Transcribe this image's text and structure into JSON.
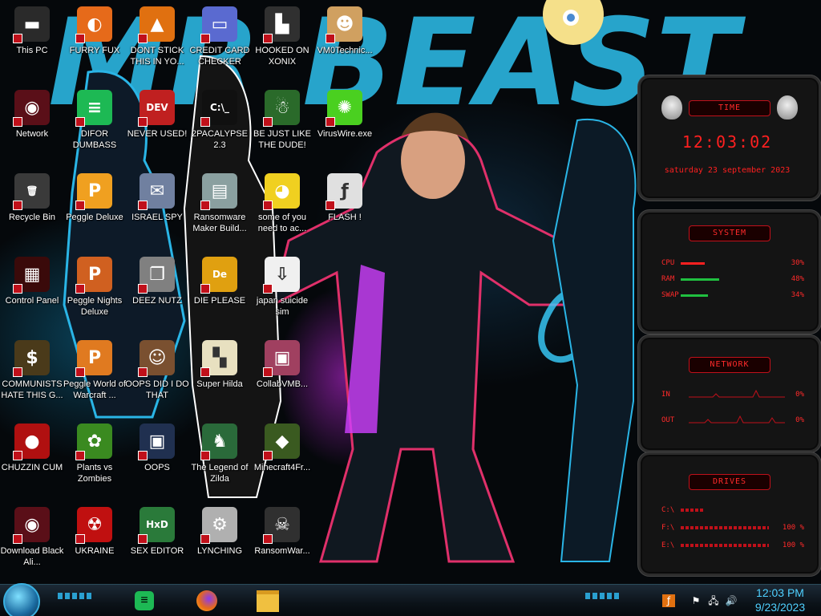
{
  "desktop": {
    "icons": [
      {
        "label": "This PC",
        "icon": "this-pc-icon",
        "bg": "#2a2a2a",
        "sym": "▬"
      },
      {
        "label": "Network",
        "icon": "network-icon",
        "bg": "#5a0f18",
        "sym": "◉"
      },
      {
        "label": "Recycle Bin",
        "icon": "recycle-bin-icon",
        "bg": "#3a3a3a",
        "sym": "🗑"
      },
      {
        "label": "Control Panel",
        "icon": "control-panel-icon",
        "bg": "#3a0a0a",
        "sym": "▦"
      },
      {
        "label": "COMMUNISTS HATE THIS G...",
        "icon": "money-bag-icon",
        "bg": "#4a3a1a",
        "sym": "$"
      },
      {
        "label": "CHUZZIN CUM",
        "icon": "chuzzle-icon",
        "bg": "#b01010",
        "sym": "●"
      },
      {
        "label": "Download Black Ali...",
        "icon": "alienware-icon",
        "bg": "#5a0f18",
        "sym": "◉"
      },
      {
        "label": "FURRY FUX",
        "icon": "firefox-icon",
        "bg": "#e66a1a",
        "sym": "◐"
      },
      {
        "label": "DIFOR DUMBASS",
        "icon": "spotify-icon",
        "bg": "#1db954",
        "sym": "≡"
      },
      {
        "label": "Peggle Deluxe",
        "icon": "peggle-icon",
        "bg": "#f0a020",
        "sym": "P"
      },
      {
        "label": "Peggle Nights Deluxe",
        "icon": "peggle-nights-icon",
        "bg": "#d06020",
        "sym": "P"
      },
      {
        "label": "Peggle World of Warcraft ...",
        "icon": "peggle-wow-icon",
        "bg": "#e07a20",
        "sym": "P"
      },
      {
        "label": "Plants vs Zombies",
        "icon": "plants-vs-zombies-icon",
        "bg": "#3a8a20",
        "sym": "✿"
      },
      {
        "label": "UKRAINE",
        "icon": "radiation-icon",
        "bg": "#c01010",
        "sym": "☢"
      },
      {
        "label": "DONT STICK THIS IN YO...",
        "icon": "vlc-icon",
        "bg": "#e07010",
        "sym": "▲"
      },
      {
        "label": "NEVER USED!",
        "icon": "dev-cpp-icon",
        "bg": "#c02020",
        "sym": "DEV"
      },
      {
        "label": "ISRAEL SPY",
        "icon": "spy-app-icon",
        "bg": "#7080a0",
        "sym": "✉"
      },
      {
        "label": "DEEZ NUTZ",
        "icon": "windows-stack-icon",
        "bg": "#808080",
        "sym": "❐"
      },
      {
        "label": "OOPS DID I DO THAT",
        "icon": "portrait-icon",
        "bg": "#7a5030",
        "sym": "☺"
      },
      {
        "label": "OOPS",
        "icon": "device-manager-icon",
        "bg": "#203050",
        "sym": "▣"
      },
      {
        "label": "SEX EDITOR",
        "icon": "hex-editor-icon",
        "bg": "#2a7a3a",
        "sym": "HxD"
      },
      {
        "label": "CREDIT CARD CHECKER",
        "icon": "credit-card-icon",
        "bg": "#5a6ad0",
        "sym": "▭"
      },
      {
        "label": "2PACALYPSE 2.3",
        "icon": "terminal-icon",
        "bg": "#101010",
        "sym": "C:\\_"
      },
      {
        "label": "Ransomware Maker Build...",
        "icon": "app-window-icon",
        "bg": "#8aa0a0",
        "sym": "▤"
      },
      {
        "label": "DIE PLEASE",
        "icon": "adobe-de-icon",
        "bg": "#e0a010",
        "sym": "De"
      },
      {
        "label": "Super Hilda",
        "icon": "pixel-dog-icon",
        "bg": "#e8e0c0",
        "sym": "▚"
      },
      {
        "label": "The Legend of Zilda",
        "icon": "pixel-link-icon",
        "bg": "#2a6a3a",
        "sym": "♞"
      },
      {
        "label": "LYNCHING",
        "icon": "gear-flag-icon",
        "bg": "#b0b0b0",
        "sym": "⚙"
      },
      {
        "label": "HOOKED ON XONIX",
        "icon": "xonix-icon",
        "bg": "#303030",
        "sym": "▙"
      },
      {
        "label": "BE JUST LIKE THE DUDE!",
        "icon": "santa-icon",
        "bg": "#2a6a2a",
        "sym": "☃"
      },
      {
        "label": "some of you need to ac...",
        "icon": "beaver-icon",
        "bg": "#f0d020",
        "sym": "◕"
      },
      {
        "label": "japan suicide sim",
        "icon": "file-icon",
        "bg": "#f0f0f0",
        "sym": "⇩"
      },
      {
        "label": "CollabVMB...",
        "icon": "monitor-icon",
        "bg": "#a04060",
        "sym": "▣"
      },
      {
        "label": "Minecraft4Fr...",
        "icon": "minecraft-block-icon",
        "bg": "#3a5a20",
        "sym": "◆"
      },
      {
        "label": "RansomWar...",
        "icon": "skull-icon",
        "bg": "#303030",
        "sym": "☠"
      },
      {
        "label": "VM0Technic...",
        "icon": "technician-icon",
        "bg": "#d0a060",
        "sym": "☻"
      },
      {
        "label": "VirusWire.exe",
        "icon": "lime-icon",
        "bg": "#4ad020",
        "sym": "✺"
      },
      {
        "label": "FLASH !",
        "icon": "flash-icon",
        "bg": "#e0e0e0",
        "sym": "ƒ"
      }
    ]
  },
  "widgets": {
    "time": {
      "title": "TIME",
      "clock": "12:03:02",
      "date": "saturday 23 september 2023"
    },
    "system": {
      "title": "SYSTEM",
      "cpu_label": "CPU",
      "cpu_value": "30%",
      "ram_label": "RAM",
      "ram_value": "48%",
      "swap_label": "SWAP",
      "swap_value": "34%",
      "cpu": 0.3,
      "ram": 0.48,
      "swap": 0.34
    },
    "network": {
      "title": "NETWORK",
      "in_label": "IN",
      "in_value": "0%",
      "out_label": "OUT",
      "out_value": "0%"
    },
    "drives": {
      "title": "DRIVES",
      "c_label": "C:\\",
      "f_label": "F:\\",
      "f_value": "100 %",
      "e_label": "E:\\",
      "e_value": "100 %"
    }
  },
  "taskbar": {
    "start": "start-orb-icon",
    "pinned": [
      "spotify-icon",
      "firefox-icon",
      "file-explorer-icon"
    ],
    "tray": [
      "flash-tray-icon",
      "security-flag-icon",
      "network-tray-icon",
      "volume-icon"
    ],
    "clock_time": "12:03 PM",
    "clock_date": "9/23/2023"
  },
  "colors": {
    "accent": "#ff2020",
    "taskbar_text": "#4fd0ff"
  }
}
